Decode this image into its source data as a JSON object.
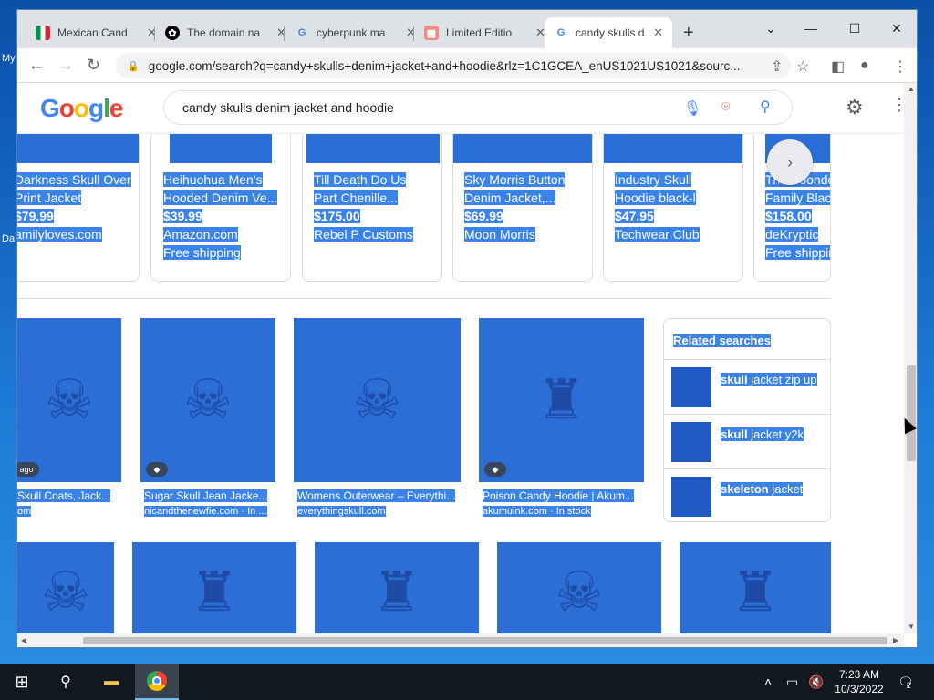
{
  "desktop": {
    "label_1": "My",
    "label_2": "Da"
  },
  "tabs": [
    {
      "title": "Mexican Cand",
      "icon": "italy-flag-icon"
    },
    {
      "title": "The domain na",
      "icon": "openai-icon"
    },
    {
      "title": "cyberpunk ma",
      "icon": "google-icon"
    },
    {
      "title": "Limited Editio",
      "icon": "store-icon"
    },
    {
      "title": "candy skulls d",
      "icon": "google-icon"
    }
  ],
  "address_bar": {
    "url": "google.com/search?q=candy+skulls+denim+jacket+and+hoodie&rlz=1C1GCEA_enUS1021US1021&sourc..."
  },
  "google": {
    "logo": "Google",
    "query": "candy skulls denim jacket and hoodie"
  },
  "shopping": [
    {
      "title_1": "Darkness Skull Over",
      "title_2": "Print Jacket",
      "price": "$79.99",
      "store": "amilyloves.com",
      "shipping": ""
    },
    {
      "title_1": "Heihuohua Men's",
      "title_2": "Hooded Denim Ve...",
      "price": "$39.99",
      "store": "Amazon.com",
      "shipping": "Free shipping"
    },
    {
      "title_1": "Till Death Do Us",
      "title_2": "Part Chenille...",
      "price": "$175.00",
      "store": "Rebel P Customs",
      "shipping": ""
    },
    {
      "title_1": "Sky Morris Button",
      "title_2": "Denim Jacket,...",
      "price": "$69.99",
      "store": "Moon Morris",
      "shipping": ""
    },
    {
      "title_1": "Industry Skull",
      "title_2": "Hoodie black-l",
      "price": "$47.95",
      "store": "Techwear Club",
      "shipping": ""
    },
    {
      "title_1": "The Boondo",
      "title_2": "Family Blac",
      "price": "$158.00",
      "store": "deKryptic",
      "shipping": "Free shippin"
    }
  ],
  "images": [
    {
      "badge": "ago",
      "caption": "Skull Coats, Jack...",
      "source": "om"
    },
    {
      "badge": "",
      "caption": "Sugar Skull Jean Jacke...",
      "source": "nicandthenewfie.com · In ..."
    },
    {
      "badge": "",
      "caption": "Womens Outerwear – Everythi...",
      "source": "everythingskull.com"
    },
    {
      "badge": "",
      "caption": "Poison Candy Hoodie | Akum...",
      "source": "akumuink.com · In stock"
    }
  ],
  "related": {
    "heading": "Related searches",
    "items": [
      {
        "bold": "skull",
        "rest": " jacket zip up"
      },
      {
        "bold": "skull",
        "rest": " jacket y2k"
      },
      {
        "bold": "skeleton",
        "rest": " jacket"
      }
    ]
  },
  "clock": {
    "time": "7:23 AM",
    "date": "10/3/2022"
  },
  "notifications": {
    "count": "2"
  }
}
